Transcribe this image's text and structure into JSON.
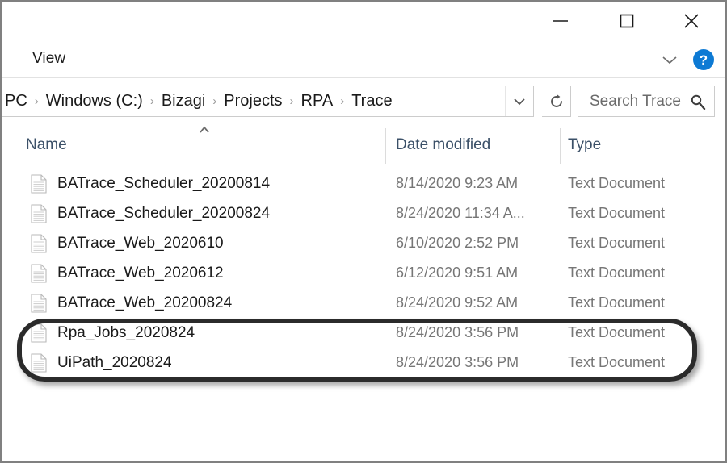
{
  "window": {
    "controls": [
      {
        "name": "minimize-button",
        "label": "—",
        "icon": "minimize-icon"
      },
      {
        "name": "maximize-button",
        "label": "□",
        "icon": "maximize-icon"
      },
      {
        "name": "close-button",
        "label": "✕",
        "icon": "close-icon"
      }
    ]
  },
  "ribbon": {
    "tab_label": "View",
    "expand_icon": "chevron-down-icon",
    "help_label": "?",
    "help_icon": "help-icon",
    "help_color": "#0d7ad4"
  },
  "address": {
    "breadcrumbs": [
      "PC",
      "Windows (C:)",
      "Bizagi",
      "Projects",
      "RPA",
      "Trace"
    ],
    "separator": "›",
    "dropdown_icon": "chevron-down-icon",
    "refresh_icon": "refresh-icon",
    "refresh_glyph": "↻"
  },
  "search": {
    "placeholder": "Search Trace",
    "value": "",
    "icon": "search-icon"
  },
  "columns": {
    "name": "Name",
    "date_modified": "Date modified",
    "type": "Type",
    "sort_icon": "sort-ascending-caret-icon",
    "header_color": "#3b5068"
  },
  "files": [
    {
      "name": "BATrace_Scheduler_20200814",
      "date_modified": "8/14/2020 9:23 AM",
      "type": "Text Document",
      "icon": "text-document-icon",
      "highlighted": false
    },
    {
      "name": "BATrace_Scheduler_20200824",
      "date_modified": "8/24/2020 11:34 A...",
      "type": "Text Document",
      "icon": "text-document-icon",
      "highlighted": false
    },
    {
      "name": "BATrace_Web_2020610",
      "date_modified": "6/10/2020 2:52 PM",
      "type": "Text Document",
      "icon": "text-document-icon",
      "highlighted": false
    },
    {
      "name": "BATrace_Web_2020612",
      "date_modified": "6/12/2020 9:51 AM",
      "type": "Text Document",
      "icon": "text-document-icon",
      "highlighted": false
    },
    {
      "name": "BATrace_Web_20200824",
      "date_modified": "8/24/2020 9:52 AM",
      "type": "Text Document",
      "icon": "text-document-icon",
      "highlighted": false
    },
    {
      "name": "Rpa_Jobs_2020824",
      "date_modified": "8/24/2020 3:56 PM",
      "type": "Text Document",
      "icon": "text-document-icon",
      "highlighted": true
    },
    {
      "name": "UiPath_2020824",
      "date_modified": "8/24/2020 3:56 PM",
      "type": "Text Document",
      "icon": "text-document-icon",
      "highlighted": true
    }
  ],
  "annotation": {
    "shape": "rounded-rectangle-highlight",
    "color": "#2b2b2b"
  }
}
